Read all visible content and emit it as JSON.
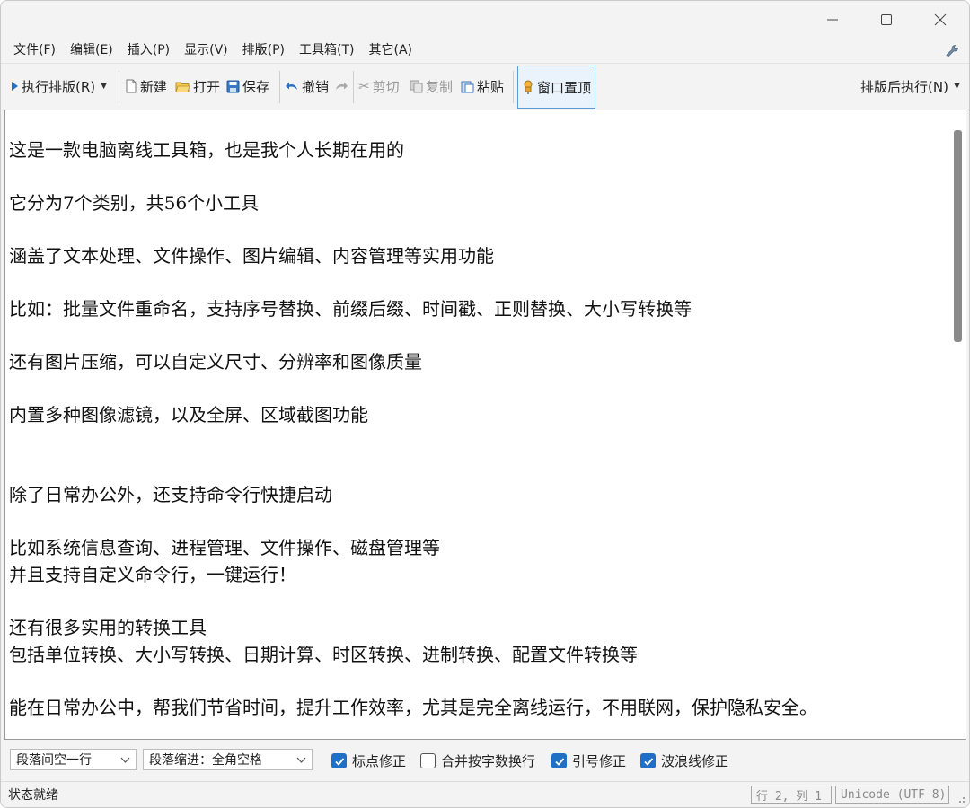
{
  "window": {
    "controls": {
      "minimize_icon": "minimize-icon",
      "maximize_icon": "maximize-icon",
      "close_icon": "close-icon"
    }
  },
  "menu": {
    "items": [
      {
        "label": "文件(F)"
      },
      {
        "label": "编辑(E)"
      },
      {
        "label": "插入(P)"
      },
      {
        "label": "显示(V)"
      },
      {
        "label": "排版(P)"
      },
      {
        "label": "工具箱(T)"
      },
      {
        "label": "其它(A)"
      }
    ],
    "right_icon": "wrench-icon"
  },
  "toolbar": {
    "run_format": "执行排版(R)",
    "new": "新建",
    "open": "打开",
    "save": "保存",
    "undo": "撤销",
    "cut": "剪切",
    "copy": "复制",
    "paste": "粘贴",
    "pin_window": "窗口置顶",
    "after_format": "排版后执行(N)"
  },
  "editor": {
    "lines": [
      "这是一款电脑离线工具箱，也是我个人长期在用的",
      "它分为7个类别，共56个小工具",
      "涵盖了文本处理、文件操作、图片编辑、内容管理等实用功能",
      "比如：批量文件重命名，支持序号替换、前缀后缀、时间戳、正则替换、大小写转换等",
      "还有图片压缩，可以自定义尺寸、分辨率和图像质量",
      "内置多种图像滤镜，以及全屏、区域截图功能",
      "除了日常办公外，还支持命令行快捷启动",
      "比如系统信息查询、进程管理、文件操作、磁盘管理等",
      "并且支持自定义命令行，一键运行！",
      "还有很多实用的转换工具",
      "包括单位转换、大小写转换、日期计算、时区转换、进制转换、配置文件转换等",
      "能在日常办公中，帮我们节省时间，提升工作效率，尤其是完全离线运行，不用联网，保护隐私安全。"
    ]
  },
  "options": {
    "para_spacing": "段落间空一行",
    "para_indent": "段落缩进：全角空格",
    "checkboxes": [
      {
        "label": "标点修正",
        "checked": true
      },
      {
        "label": "合并按字数换行",
        "checked": false
      },
      {
        "label": "引号修正",
        "checked": true
      },
      {
        "label": "波浪线修正",
        "checked": true
      }
    ]
  },
  "status": {
    "text": "状态就绪",
    "position": "行 2, 列 1",
    "encoding": "Unicode (UTF-8)"
  },
  "colors": {
    "accent": "#1f6fc5",
    "pin_border": "#5b9bd5"
  }
}
